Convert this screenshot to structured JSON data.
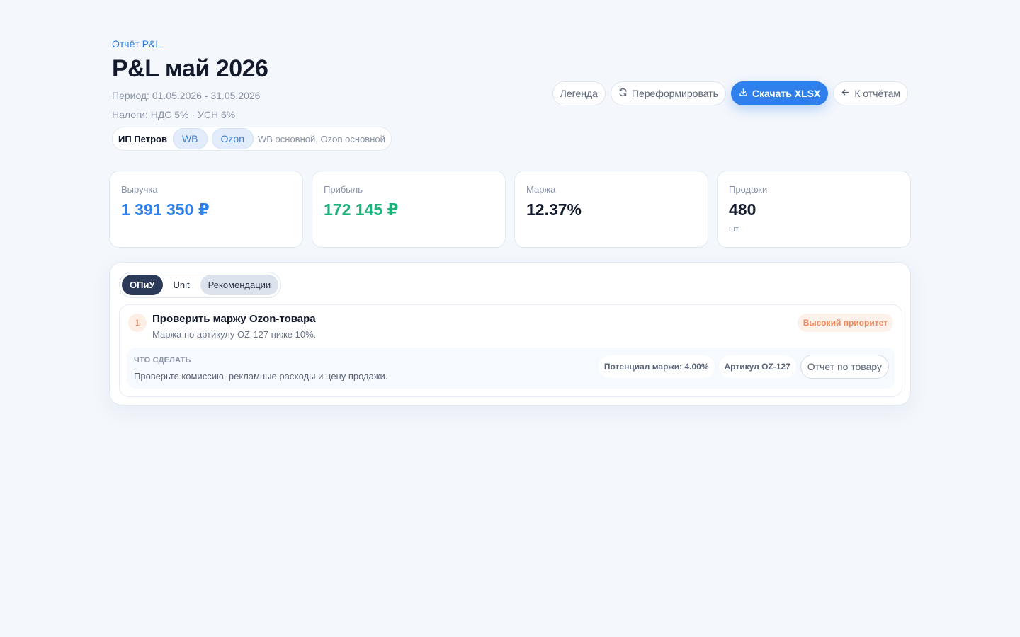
{
  "header": {
    "breadcrumb": "Отчёт P&L",
    "title": "P&L май 2026",
    "period": "Период: 01.05.2026 - 31.05.2026",
    "taxes": "Налоги: НДС 5% · УСН 6%"
  },
  "entity": {
    "name": "ИП Петров",
    "marketplaces": [
      "WB",
      "Ozon"
    ],
    "note": "WB основной, Ozon основной"
  },
  "actions": {
    "legend": "Легенда",
    "regenerate": "Переформировать",
    "download": "Скачать XLSX",
    "back": "К отчётам"
  },
  "kpis": [
    {
      "label": "Выручка",
      "value": "1 391 350 ₽",
      "color": "#2f80ed",
      "unit": ""
    },
    {
      "label": "Прибыль",
      "value": "172 145 ₽",
      "color": "#1fb07a",
      "unit": ""
    },
    {
      "label": "Маржа",
      "value": "12.37%",
      "color": "#131a2b",
      "unit": ""
    },
    {
      "label": "Продажи",
      "value": "480",
      "color": "#131a2b",
      "unit": "шт."
    }
  ],
  "tabs": [
    "ОПиУ",
    "Unit",
    "Рекомендации"
  ],
  "recommendation": {
    "number": "1",
    "title": "Проверить маржу Ozon-товара",
    "description": "Маржа по артикулу OZ-127 ниже 10%.",
    "priority": "Высокий приоритет",
    "todo_label": "ЧТО СДЕЛАТЬ",
    "todo_text": "Проверьте комиссию, рекламные расходы и цену продажи.",
    "potential": "Потенциал маржи: 4.00%",
    "sku": "Артикул OZ-127",
    "product_report": "Отчет по товару"
  },
  "icons": {
    "regenerate": "refresh-icon",
    "download": "download-icon",
    "back": "arrow-left-icon"
  }
}
